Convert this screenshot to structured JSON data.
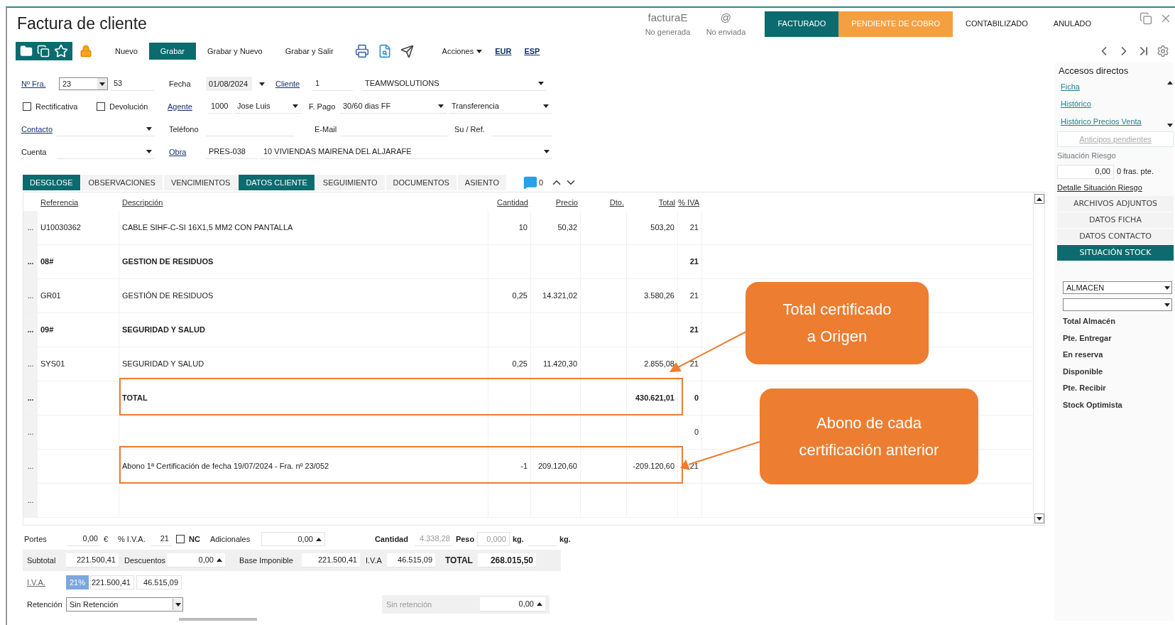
{
  "window": {
    "title": "Factura de cliente"
  },
  "einvoice": [
    {
      "title": "facturaE",
      "status": "No generada"
    },
    {
      "title": "@",
      "status": "No enviada"
    }
  ],
  "statuses": [
    {
      "label": "FACTURADO",
      "color": "#0b6b6e"
    },
    {
      "label": "PENDIENTE DE COBRO",
      "color": "#f5a040"
    },
    {
      "label": "CONTABILIZADO",
      "color": "#ffffff"
    },
    {
      "label": "ANULADO",
      "color": "#ffffff"
    }
  ],
  "toolbar": {
    "buttons": [
      {
        "label": "Nuevo",
        "selected": false
      },
      {
        "label": "Grabar",
        "selected": true
      },
      {
        "label": "Grabar y Nuevo",
        "selected": false
      },
      {
        "label": "Grabar y Salir",
        "selected": false
      }
    ],
    "actions": "Acciones",
    "currency": "EUR",
    "language": "ESP"
  },
  "form": {
    "invoice_no": {
      "label": "Nº Fra.",
      "series": "23",
      "number": "53"
    },
    "date": {
      "label": "Fecha",
      "value": "01/08/2024"
    },
    "client": {
      "label": "Cliente",
      "code": "1",
      "name": "TEAMWSOLUTIONS"
    },
    "checkboxes": [
      {
        "label": "Rectificativa",
        "checked": false
      },
      {
        "label": "Devolución",
        "checked": false
      }
    ],
    "agent": {
      "label": "Agente",
      "code": "1000",
      "name": "Jose Luis"
    },
    "payment": {
      "label": "F. Pago",
      "term": "30/60 dias FF",
      "method": "Transferencia"
    },
    "contact": {
      "label": "Contacto"
    },
    "phone": {
      "label": "Teléfono"
    },
    "email": {
      "label": "E-Mail"
    },
    "reference": {
      "label": "Su / Ref."
    },
    "account": {
      "label": "Cuenta"
    },
    "project": {
      "label": "Obra",
      "code": "PRES-038",
      "name": "10 VIVIENDAS MAIRENA DEL ALJARAFE"
    }
  },
  "tabs": [
    {
      "label": "DESGLOSE",
      "selected": true
    },
    {
      "label": "OBSERVACIONES",
      "selected": false
    },
    {
      "label": "VENCIMIENTOS",
      "selected": false
    },
    {
      "label": "DATOS CLIENTE",
      "selected": true
    },
    {
      "label": "SEGUIMIENTO",
      "selected": false
    },
    {
      "label": "DOCUMENTOS",
      "selected": false
    },
    {
      "label": "ASIENTO",
      "selected": false
    }
  ],
  "comments": {
    "count": "0"
  },
  "table": {
    "columns": [
      "Referencia",
      "Descripción",
      "Cantidad",
      "Precio",
      "Dto.",
      "Total",
      "% IVA"
    ],
    "rows": [
      {
        "kind": "item",
        "marker": "...",
        "reference": "U10030362",
        "description": "CABLE SIHF-C-SI 16X1,5 MM2 CON PANTALLA",
        "quantity": "10",
        "price": "50,32",
        "total": "503,20",
        "vat": "21",
        "highlighted": false
      },
      {
        "kind": "chapter",
        "marker": "...",
        "reference": "08#",
        "description": "GESTION DE RESIDUOS",
        "vat": "21",
        "highlighted": false
      },
      {
        "kind": "item",
        "marker": "...",
        "reference": "GR01",
        "description": "GESTIÓN DE RESIDUOS",
        "quantity": "0,25",
        "price": "14.321,02",
        "total": "3.580,26",
        "vat": "21",
        "highlighted": false
      },
      {
        "kind": "chapter",
        "marker": "...",
        "reference": "09#",
        "description": "SEGURIDAD Y SALUD",
        "vat": "21",
        "highlighted": false
      },
      {
        "kind": "item",
        "marker": "...",
        "reference": "SYS01",
        "description": "SEGURIDAD Y SALUD",
        "quantity": "0,25",
        "price": "11.420,30",
        "total": "2.855,08",
        "vat": "21",
        "highlighted": false
      },
      {
        "kind": "total",
        "marker": "...",
        "description": "TOTAL",
        "total": "430.621,01",
        "vat": "0",
        "highlighted": true
      },
      {
        "kind": "item",
        "marker": "...",
        "vat": "0",
        "highlighted": false
      },
      {
        "kind": "item",
        "marker": "...",
        "description": "Abono 1ª Certificación de fecha 19/07/2024 - Fra. nº 23/052",
        "quantity": "-1",
        "price": "209.120,60",
        "total": "-209.120,60",
        "vat": "21",
        "highlighted": true
      },
      {
        "kind": "item",
        "marker": "...",
        "highlighted": false
      }
    ]
  },
  "callouts": [
    {
      "lines": [
        "Total certificado",
        "a Origen"
      ]
    },
    {
      "lines": [
        "Abono de cada",
        "certificación anterior"
      ]
    }
  ],
  "footer": {
    "shipping": {
      "label": "Portes",
      "value": "0,00",
      "unit": "€"
    },
    "vat_rate": {
      "label": "% I.V.A.",
      "value": "21"
    },
    "nc": {
      "label": "NC",
      "checked": false
    },
    "extras": {
      "label": "Adicionales",
      "value": "0,00"
    },
    "quantity": {
      "label": "Cantidad",
      "value": "4.338,28"
    },
    "weight": {
      "label": "Peso",
      "value": "0,000",
      "unit": "kg.",
      "unit2": "kg."
    },
    "subtotal": {
      "label": "Subtotal",
      "value": "221.500,41"
    },
    "discounts": {
      "label": "Descuentos",
      "value": "0,00"
    },
    "tax_base": {
      "label": "Base Imponible",
      "value": "221.500,41"
    },
    "vat": {
      "label": "I.V.A",
      "value": "46.515,09"
    },
    "total": {
      "label": "TOTAL",
      "value": "268.015,50"
    },
    "vat_breakdown": {
      "label": "I.V.A.",
      "rate": "21%",
      "base": "221.500,41",
      "amount": "46.515,09"
    },
    "withholding": {
      "label": "Retención",
      "value": "Sin Retención",
      "status": "Sin retención",
      "amount": "0,00"
    }
  },
  "side_panel": {
    "title": "Accesos directos",
    "shortcuts": [
      "Ficha",
      "Histórico",
      "Histórico Precios Venta"
    ],
    "advances": {
      "label": "Anticipos pendientes",
      "disabled": true
    },
    "risk": {
      "label": "Situación Riesgo",
      "amount": "0,00",
      "pending": "0 fras. pte.",
      "detail": "Detalle Situación Riesgo"
    },
    "sections": [
      {
        "label": "ARCHIVOS ADJUNTOS",
        "selected": false
      },
      {
        "label": "DATOS FICHA",
        "selected": false
      },
      {
        "label": "DATOS CONTACTO",
        "selected": false
      },
      {
        "label": "SITUACIÓN STOCK",
        "selected": true
      }
    ],
    "warehouse": "ALMACEN",
    "stock_labels": [
      "Total Almacén",
      "Pte. Entregar",
      "En reserva",
      "Disponible",
      "Pte. Recibir",
      "Stock Optimista"
    ]
  }
}
